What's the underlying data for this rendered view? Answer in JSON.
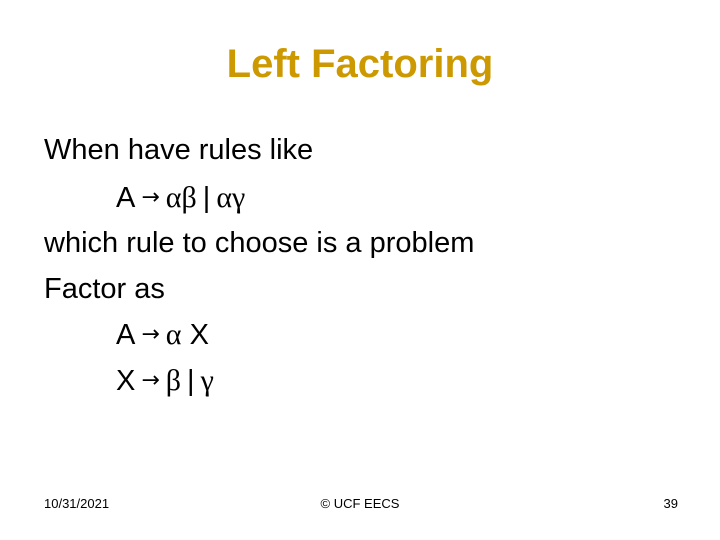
{
  "slide": {
    "title": "Left Factoring",
    "body": {
      "line1": "When have rules like",
      "rule1": {
        "lhs": "A",
        "arrow": "→",
        "rhs_a": "αβ",
        "bar": "|",
        "rhs_b": "αγ"
      },
      "line3": "which rule to choose is a problem",
      "line4": "Factor as",
      "rule2": {
        "lhs": "A",
        "arrow": "→",
        "rhs_a": "α",
        "rhs_b": "X"
      },
      "rule3": {
        "lhs": "X",
        "arrow": "→",
        "rhs_a": "β",
        "bar": "|",
        "rhs_b": "γ"
      }
    },
    "footer": {
      "date": "10/31/2021",
      "center": "© UCF EECS",
      "page": "39"
    },
    "colors": {
      "title": "#cc9900",
      "text": "#000000",
      "background": "#ffffff"
    }
  }
}
